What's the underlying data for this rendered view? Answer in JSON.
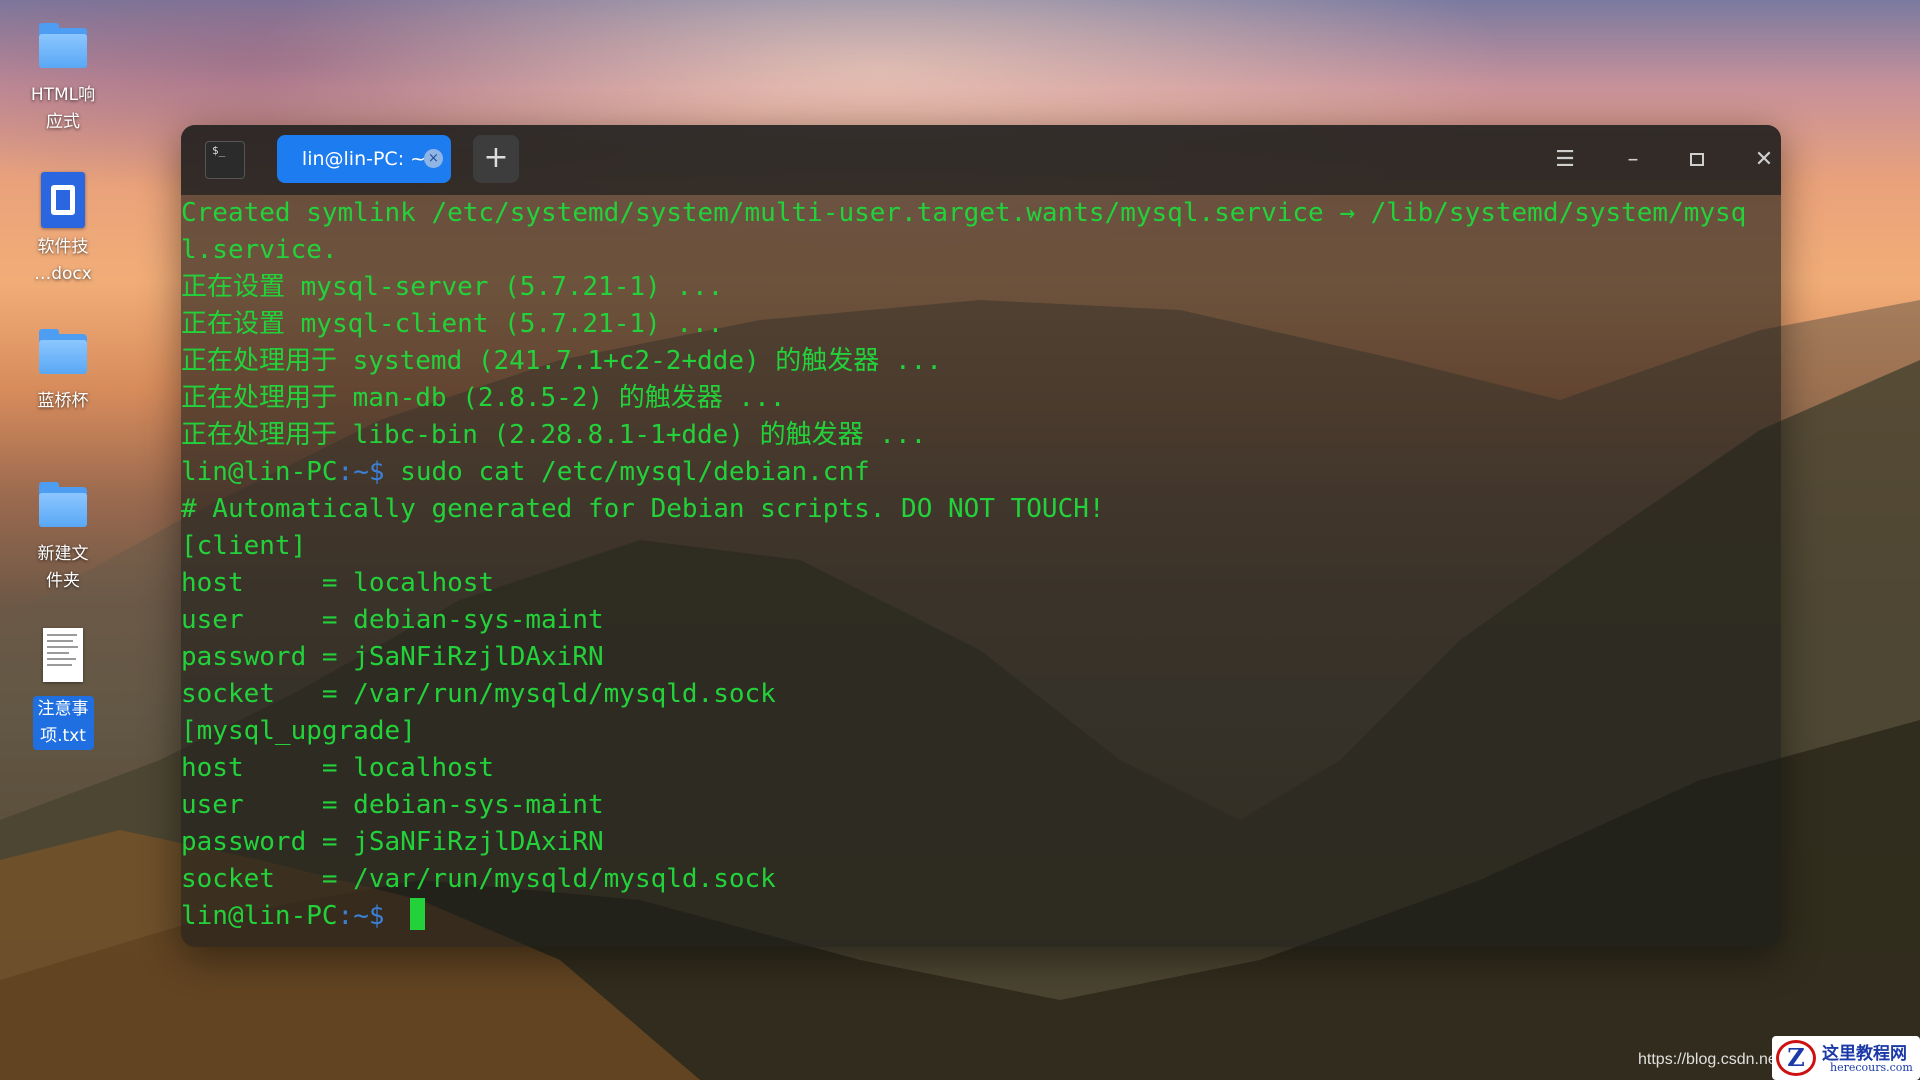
{
  "desktop": {
    "icons": [
      {
        "label": "HTML响\n应式",
        "icon": "folder-icon"
      },
      {
        "label": "软件技\n…docx",
        "icon": "docx-icon"
      },
      {
        "label": "蓝桥杯",
        "icon": "folder-icon"
      },
      {
        "label": "新建文\n件夹",
        "icon": "folder-icon"
      },
      {
        "label": "注意事\n项.txt",
        "icon": "txt-file-icon",
        "selected": true
      }
    ]
  },
  "terminal": {
    "tab_title": "lin@lin-PC: ~",
    "tab_close_glyph": "×",
    "add_tab_glyph": "+",
    "menu_icon_text": "$_",
    "window_buttons": {
      "menu": "☰",
      "minimize": "–",
      "close": "✕"
    },
    "lines": [
      "Created symlink /etc/systemd/system/multi-user.target.wants/mysql.service → /lib/systemd/system/mysq",
      "l.service.",
      "正在设置 mysql-server (5.7.21-1) ...",
      "正在设置 mysql-client (5.7.21-1) ...",
      "正在处理用于 systemd (241.7.1+c2-2+dde) 的触发器 ...",
      "正在处理用于 man-db (2.8.5-2) 的触发器 ...",
      "正在处理用于 libc-bin (2.28.8.1-1+dde) 的触发器 ...",
      "# Automatically generated for Debian scripts. DO NOT TOUCH!",
      "[client]",
      "host     = localhost",
      "user     = debian-sys-maint",
      "password = jSaNFiRzjlDAxiRN",
      "socket   = /var/run/mysqld/mysqld.sock",
      "[mysql_upgrade]",
      "host     = localhost",
      "user     = debian-sys-maint",
      "password = jSaNFiRzjlDAxiRN",
      "socket   = /var/run/mysqld/mysqld.sock"
    ],
    "prompt_user": "lin@lin-PC",
    "prompt_path": ":~",
    "prompt_symbol": "$ ",
    "command": "sudo cat /etc/mysql/debian.cnf"
  },
  "watermark": {
    "url": "https://blog.csdn.ne",
    "logo_letter": "Z",
    "logo_cn": "这里教程网",
    "logo_en": "herecours.com"
  },
  "colors": {
    "terminal_green": "#23d23a",
    "prompt_path_blue": "#3b7fd6",
    "tab_active_blue": "#1d7cf0"
  }
}
